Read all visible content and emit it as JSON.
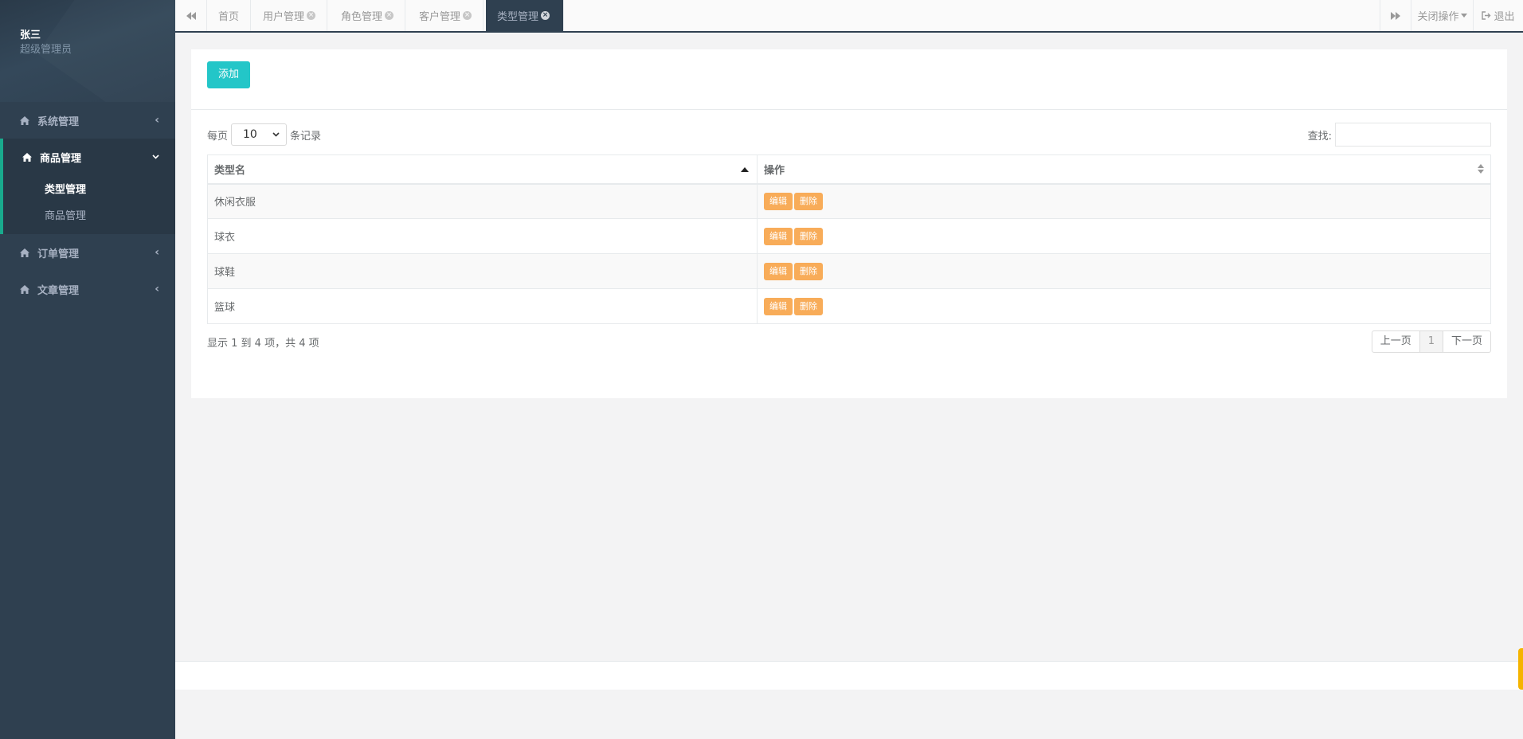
{
  "user": {
    "name": "张三",
    "role": "超级管理员"
  },
  "sidebar": {
    "groups": [
      {
        "label": "系统管理"
      },
      {
        "label": "商品管理",
        "children": [
          "类型管理",
          "商品管理"
        ]
      },
      {
        "label": "订单管理"
      },
      {
        "label": "文章管理"
      }
    ]
  },
  "tabs": [
    {
      "label": "首页"
    },
    {
      "label": "用户管理"
    },
    {
      "label": "角色管理"
    },
    {
      "label": "客户管理"
    },
    {
      "label": "类型管理"
    }
  ],
  "topbar": {
    "close_ops": "关闭操作",
    "logout": "退出"
  },
  "toolbar": {
    "add": "添加",
    "per_page_prefix": "每页",
    "per_page_value": "10",
    "per_page_suffix": "条记录",
    "search_label": "查找:"
  },
  "table": {
    "headers": [
      "类型名",
      "操作"
    ],
    "rows": [
      {
        "name": "休闲衣服"
      },
      {
        "name": "球衣"
      },
      {
        "name": "球鞋"
      },
      {
        "name": "篮球"
      }
    ],
    "edit_label": "编辑",
    "delete_label": "删除"
  },
  "footer": {
    "info": "显示 1 到 4 项，共 4 项",
    "prev": "上一页",
    "page": "1",
    "next": "下一页"
  },
  "colors": {
    "sidebar": "#2f4050",
    "accent": "#19aa8d",
    "add_button": "#23c6c8",
    "action_button": "#f8ac59"
  }
}
